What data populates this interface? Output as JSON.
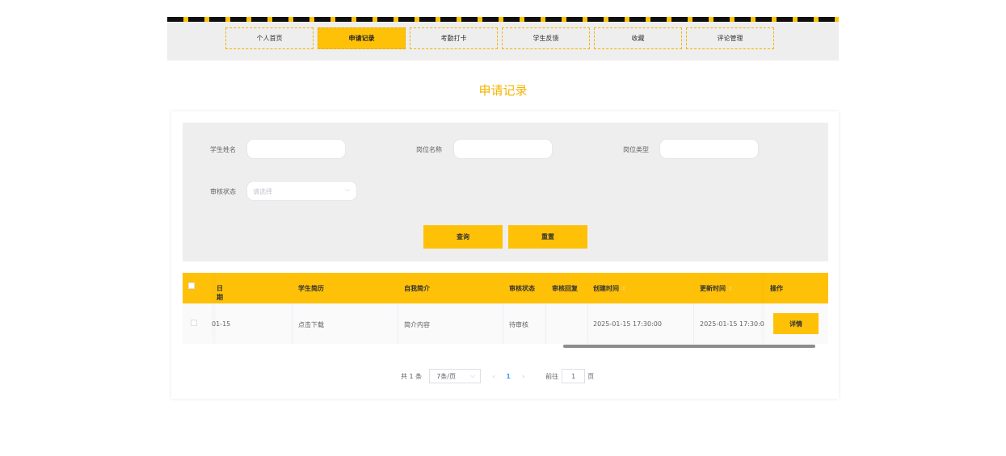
{
  "nav": {
    "tabs": [
      {
        "label": "个人首页",
        "active": false
      },
      {
        "label": "申请记录",
        "active": true
      },
      {
        "label": "考勤打卡",
        "active": false
      },
      {
        "label": "学生反馈",
        "active": false
      },
      {
        "label": "收藏",
        "active": false
      },
      {
        "label": "评论管理",
        "active": false
      }
    ]
  },
  "page_title": "申请记录",
  "filters": {
    "student_name_label": "学生姓名",
    "student_name_value": "",
    "position_name_label": "岗位名称",
    "position_name_value": "",
    "position_type_label": "岗位类型",
    "position_type_value": "",
    "review_status_label": "审核状态",
    "review_status_placeholder": "请选择",
    "query_label": "查询",
    "reset_label": "重置"
  },
  "table": {
    "headers": {
      "date": "日期",
      "resume": "学生简历",
      "intro": "自我简介",
      "status": "审核状态",
      "reply": "审核回复",
      "created": "创建时间",
      "updated": "更新时间",
      "action": "操作"
    },
    "rows": [
      {
        "date": "01-15",
        "resume": "点击下载",
        "intro": "简介内容",
        "status": "待审核",
        "reply": "",
        "created": "2025-01-15 17:30:00",
        "updated": "2025-01-15 17:30:0",
        "action": "详情"
      }
    ]
  },
  "pagination": {
    "total": "共 1 条",
    "page_size": "7条/页",
    "current_page": "1",
    "goto_prefix": "前往",
    "goto_value": "1",
    "goto_suffix": "页"
  },
  "colors": {
    "accent": "#ffc107",
    "title": "#f5b400",
    "filter_bg": "#eeeeee",
    "page_active": "#409eff"
  }
}
